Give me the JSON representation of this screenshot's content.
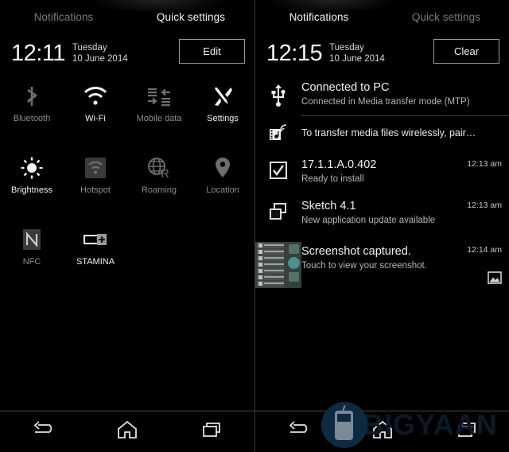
{
  "left_panel": {
    "tabs": [
      {
        "label": "Notifications",
        "active": false
      },
      {
        "label": "Quick settings",
        "active": true
      }
    ],
    "clock": "12:11",
    "day": "Tuesday",
    "date": "10 June 2014",
    "header_button": "Edit",
    "tiles": [
      {
        "label": "Bluetooth",
        "icon": "bluetooth-icon",
        "state": "off"
      },
      {
        "label": "Wi-Fi",
        "icon": "wifi-icon",
        "state": "on"
      },
      {
        "label": "Mobile data",
        "icon": "mobile-data-icon",
        "state": "off"
      },
      {
        "label": "Settings",
        "icon": "settings-icon",
        "state": "on"
      },
      {
        "label": "Brightness",
        "icon": "brightness-icon",
        "state": "on"
      },
      {
        "label": "Hotspot",
        "icon": "hotspot-icon",
        "state": "off"
      },
      {
        "label": "Roaming",
        "icon": "roaming-icon",
        "state": "off"
      },
      {
        "label": "Location",
        "icon": "location-pin-icon",
        "state": "off"
      },
      {
        "label": "NFC",
        "icon": "nfc-icon",
        "state": "off"
      },
      {
        "label": "STAMINA",
        "icon": "stamina-battery-icon",
        "state": "on"
      }
    ]
  },
  "right_panel": {
    "tabs": [
      {
        "label": "Notifications",
        "active": true
      },
      {
        "label": "Quick settings",
        "active": false
      }
    ],
    "clock": "12:15",
    "day": "Tuesday",
    "date": "10 June 2014",
    "header_button": "Clear",
    "notifications": [
      {
        "icon": "usb-icon",
        "title": "Connected to PC",
        "subtitle": "Connected in Media transfer mode (MTP)",
        "time": ""
      },
      {
        "icon": "media-wireless-icon",
        "title": "To transfer media files wirelessly, pair…",
        "subtitle": "",
        "time": ""
      },
      {
        "icon": "checkbox-icon",
        "title": "17.1.1.A.0.402",
        "subtitle": "Ready to install",
        "time": "12:13 am"
      },
      {
        "icon": "app-update-icon",
        "title": "Sketch 4.1",
        "subtitle": "New application update available",
        "time": "12:13 am"
      },
      {
        "icon": "screenshot-thumbnail",
        "title": "Screenshot captured.",
        "subtitle": "Touch to view your screenshot.",
        "time": "12:14 am"
      }
    ]
  },
  "navbar": {
    "buttons": [
      {
        "name": "back-button",
        "icon": "back-arrow-icon"
      },
      {
        "name": "home-button",
        "icon": "home-icon"
      },
      {
        "name": "recents-button",
        "icon": "recents-icon"
      }
    ]
  },
  "watermark": {
    "text": "BIGYAAN",
    "color": "#0c1a28"
  },
  "colors": {
    "background": "#000000",
    "active_text": "#f2f2f2",
    "inactive_text": "#7b7b7b",
    "divider": "#3b3b3b"
  }
}
